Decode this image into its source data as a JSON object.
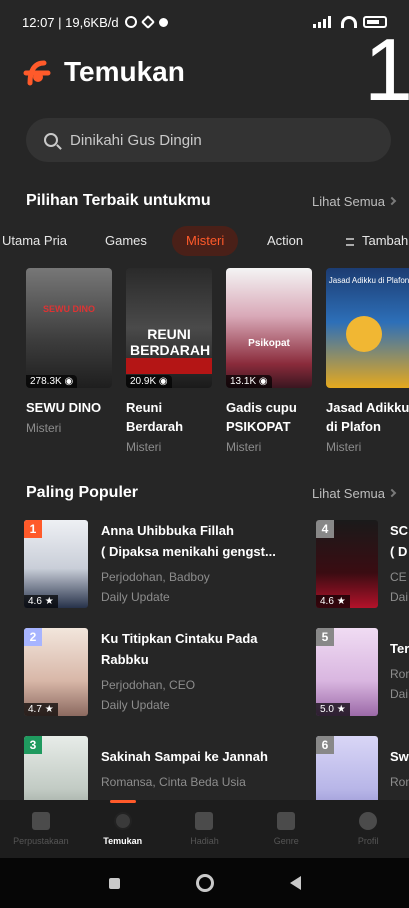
{
  "status_bar": {
    "time_speed": "12:07 | 19,6KB/d"
  },
  "header": {
    "title": "Temukan",
    "overlay_number": "1"
  },
  "search": {
    "placeholder": "Dinikahi Gus Dingin"
  },
  "recommended": {
    "heading": "Pilihan Terbaik untukmu",
    "see_all": "Lihat Semua",
    "chips": [
      "Utama Pria",
      "Games",
      "Misteri",
      "Action",
      "Tambah"
    ],
    "active_chip": "Misteri",
    "cards": [
      {
        "title": "SEWU DINO",
        "genre": "Misteri",
        "views": "278.3K",
        "cover_color": "#5b5b5b",
        "cover_text": "SEWU DINO"
      },
      {
        "title": "Reuni Berdarah",
        "genre": "Misteri",
        "views": "20.9K",
        "cover_color": "#3b3b3b",
        "cover_text": "REUNI BERDARAH"
      },
      {
        "title": "Gadis cupu PSIKOPAT",
        "genre": "Misteri",
        "views": "13.1K",
        "cover_color": "#4a2a36",
        "cover_text": "Psikopat"
      },
      {
        "title": "Jasad Adikku di Plafon",
        "genre": "Misteri",
        "views": "",
        "cover_color": "#2d6fb8",
        "cover_text": "Jasad Adikku di Plafon"
      }
    ]
  },
  "popular": {
    "heading": "Paling Populer",
    "see_all": "Lihat Semua",
    "items": [
      {
        "rank": "1",
        "rank_color": "#ff5a2a",
        "title": "Anna Uhibbuka Fillah",
        "title2": "( Dipaksa menikahi gengst...",
        "tags": "Perjodohan, Badboy",
        "update": "Daily Update",
        "rating": "4.6",
        "cover_color": "#dfe3ea"
      },
      {
        "rank": "2",
        "rank_color": "#a7b4ff",
        "title": "Ku Titipkan Cintaku Pada",
        "title2": "Rabbku",
        "tags": "Perjodohan, CEO",
        "update": "Daily Update",
        "rating": "4.7",
        "cover_color": "#e4cfc7"
      },
      {
        "rank": "3",
        "rank_color": "#1f9a5f",
        "title": "Sakinah Sampai ke Jannah",
        "title2": "",
        "tags": "Romansa, Cinta Beda Usia",
        "update": "",
        "rating": "",
        "cover_color": "#cfd8d0"
      },
      {
        "rank": "4",
        "rank_color": "#888888",
        "title": "SC",
        "title2": "( D",
        "tags": "CE",
        "update": "Dai",
        "rating": "4.6",
        "cover_color": "#1a1a1a"
      },
      {
        "rank": "5",
        "rank_color": "#888888",
        "title": "Ter",
        "title2": "",
        "tags": "Ron",
        "update": "Dai",
        "rating": "5.0",
        "cover_color": "#e2c7ea"
      },
      {
        "rank": "6",
        "rank_color": "#888888",
        "title": "Sw",
        "title2": "",
        "tags": "Ron",
        "update": "",
        "rating": "",
        "cover_color": "#b8b6e8"
      }
    ]
  },
  "bottom_nav": [
    {
      "label": "Perpustakaan",
      "active": false
    },
    {
      "label": "Temukan",
      "active": true
    },
    {
      "label": "Hadiah",
      "active": false
    },
    {
      "label": "Genre",
      "active": false
    },
    {
      "label": "Profil",
      "active": false
    }
  ],
  "colors": {
    "accent": "#ff5a2a",
    "background": "#262626"
  }
}
